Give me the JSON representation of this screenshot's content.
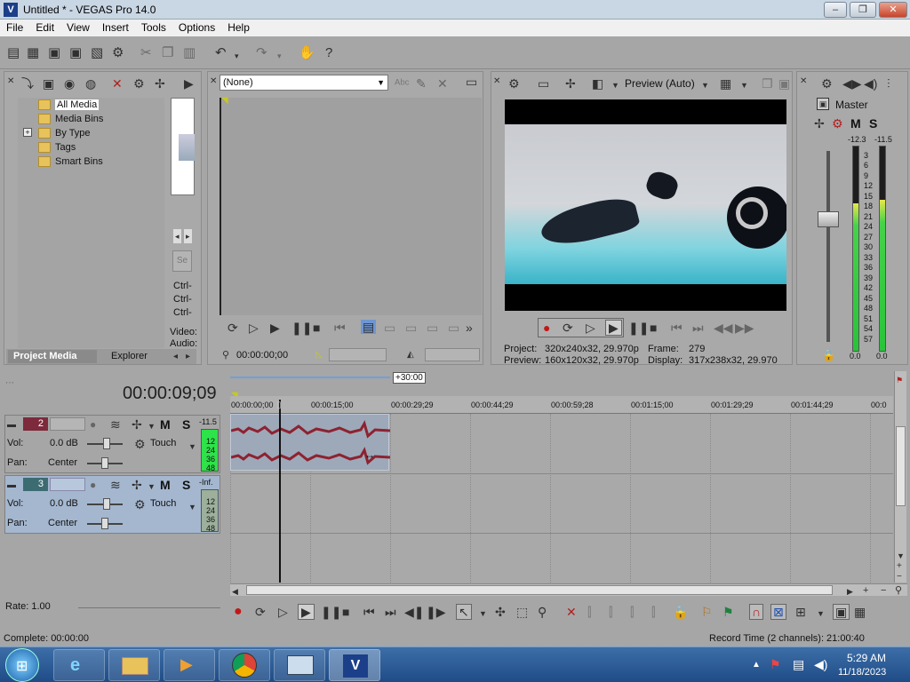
{
  "window": {
    "title": "Untitled * - VEGAS Pro 14.0",
    "min": "–",
    "max": "❐",
    "close": "✕"
  },
  "menu": [
    "File",
    "Edit",
    "View",
    "Insert",
    "Tools",
    "Options",
    "Help"
  ],
  "project_media": {
    "tree": [
      "All Media",
      "Media Bins",
      "By Type",
      "Tags",
      "Smart Bins"
    ],
    "expander": "+",
    "tabs": [
      "Project Media",
      "Explorer"
    ],
    "side_labels": [
      "Ctrl-",
      "Ctrl-",
      "Ctrl-",
      "Video:",
      "Audio:"
    ]
  },
  "trimmer": {
    "select_value": "(None)",
    "timecode": "00:00:00;00"
  },
  "preview": {
    "mode": "Preview (Auto)",
    "project_label": "Project:",
    "project_value": "320x240x32, 29.970p",
    "frame_label": "Frame:",
    "frame_value": "279",
    "preview_label": "Preview:",
    "preview_value": "160x120x32, 29.970p",
    "display_label": "Display:",
    "display_value": "317x238x32, 29.970"
  },
  "mixer": {
    "title": "Master",
    "peak_left": "-12.3",
    "peak_right": "-11.5",
    "scale": [
      "3",
      "6",
      "9",
      "12",
      "15",
      "18",
      "21",
      "24",
      "27",
      "30",
      "33",
      "36",
      "39",
      "42",
      "45",
      "48",
      "51",
      "54",
      "57"
    ],
    "level_left": "0.0",
    "level_right": "0.0",
    "meter_left": 0.72,
    "meter_right": 0.74
  },
  "timeline": {
    "time": "00:00:09;09",
    "region": "+30:00",
    "ruler": [
      "00:00:00;00",
      "00:00:15;00",
      "00:00:29;29",
      "00:00:44;29",
      "00:00:59;28",
      "00:01:15;00",
      "00:01:29;29",
      "00:01:44;29",
      "00:0"
    ],
    "tracks": [
      {
        "number": "2",
        "vol_label": "Vol:",
        "vol": "0.0 dB",
        "pan_label": "Pan:",
        "pan": "Center",
        "mode": "Touch",
        "meter_peak": "-11.5",
        "meter_scale": [
          "12",
          "24",
          "36",
          "48"
        ]
      },
      {
        "number": "3",
        "vol_label": "Vol:",
        "vol": "0.0 dB",
        "pan_label": "Pan:",
        "pan": "Center",
        "mode": "Touch",
        "meter_peak": "-Inf.",
        "meter_scale": [
          "12",
          "24",
          "36",
          "48"
        ]
      }
    ],
    "m": "M",
    "s": "S"
  },
  "status": {
    "rate": "Rate: 1.00",
    "complete": "Complete: 00:00:00",
    "record_time": "Record Time (2 channels): 21:00:40"
  },
  "taskbar": {
    "time": "5:29 AM",
    "date": "11/18/2023"
  }
}
